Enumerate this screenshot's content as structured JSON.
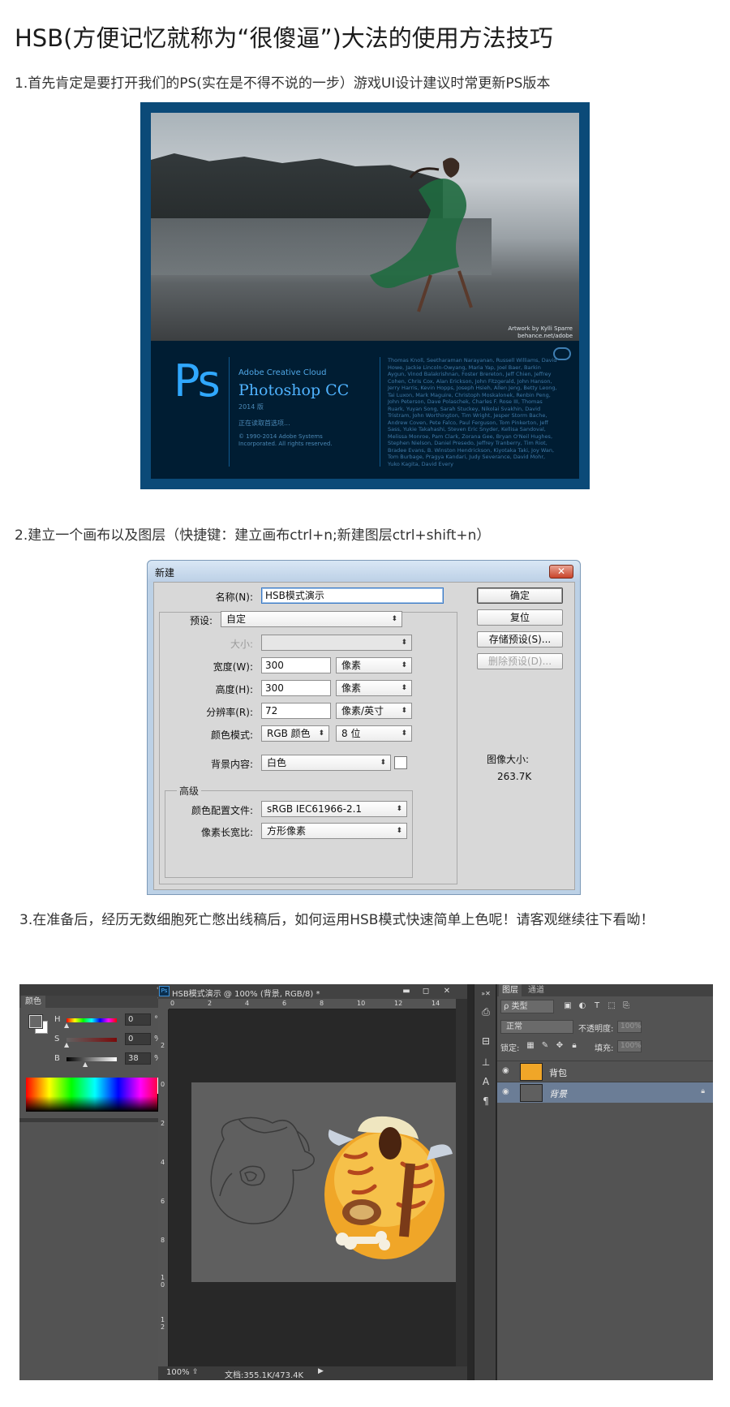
{
  "article": {
    "title": "HSB(方便记忆就称为“很傻逼”)大法的使用方法技巧",
    "step1": "1.首先肯定是要打开我们的PS(实在是不得不说的一步）游戏UI设计建议时常更新PS版本",
    "step2": "2.建立一个画布以及图层（快捷键：建立画布ctrl+n;新建图层ctrl+shift+n）",
    "step3": "3.在准备后，经历无数细胞死亡憋出线稿后，如何运用HSB模式快速简单上色呢！请客观继续往下看呦！"
  },
  "splash": {
    "artwork_credit": "Artwork by Kylli Sparre",
    "artwork_site": "behance.net/adobe",
    "logo": "Ps",
    "suite": "Adobe Creative Cloud",
    "product": "Photoshop CC",
    "year": "2014 版",
    "loading": "正在读取首选项...",
    "copyright": "© 1990-2014 Adobe Systems Incorporated. All rights reserved.",
    "credits": "Thomas Knoll, Seetharaman Narayanan, Russell Williams, David Howe, Jackie Lincoln-Owyang, Maria Yap, Joel Baer, Barkin Aygun, Vinod Balakrishnan, Foster Brereton, Jeff Chien, Jeffrey Cohen, Chris Cox, Alan Erickson, John Fitzgerald, John Hanson, Jerry Harris, Kevin Hopps, Joseph Hsieh, Allen Jeng, Betty Leong, Tai Luxon, Mark Maguire, Christoph Moskalonek, Renbin Peng, John Peterson, Dave Polaschek, Charles F. Rose III, Thomas Ruark, Yuyan Song, Sarah Stuckey, Nikolai Svakhin, David Tristram, John Worthington, Tim Wright, Jesper Storm Bache, Andrew Coven, Pete Falco, Paul Ferguson, Tom Pinkerton, Jeff Sass, Yukie Takahashi, Steven Eric Snyder, Kellisa Sandoval, Melissa Monroe, Pam Clark, Zorana Gee, Bryan O'Neil Hughes, Stephen Nielson, Daniel Presedo, Jeffrey Tranberry, Tim Riot, Bradee Evans, B. Winston Hendrickson, Kiyotaka Taki, Joy Wan, Tom Burbage, Pragya Kandari, Judy Severance, David Mohr, Yuko Kagita, David Every"
  },
  "dialog": {
    "title": "新建",
    "close": "✕",
    "name_label": "名称(N):",
    "name_value": "HSB模式演示",
    "preset_label": "预设:",
    "preset_value": "自定",
    "size_label": "大小:",
    "width_label": "宽度(W):",
    "width_value": "300",
    "width_unit": "像素",
    "height_label": "高度(H):",
    "height_value": "300",
    "height_unit": "像素",
    "resolution_label": "分辨率(R):",
    "resolution_value": "72",
    "resolution_unit": "像素/英寸",
    "mode_label": "颜色模式:",
    "mode_value": "RGB 颜色",
    "depth_value": "8 位",
    "bg_label": "背景内容:",
    "bg_value": "白色",
    "advanced_label": "高级",
    "profile_label": "颜色配置文件:",
    "profile_value": "sRGB IEC61966-2.1",
    "aspect_label": "像素长宽比:",
    "aspect_value": "方形像素",
    "btn_ok": "确定",
    "btn_reset": "复位",
    "btn_save": "存储预设(S)...",
    "btn_delete": "删除预设(D)...",
    "image_size_label": "图像大小:",
    "image_size_value": "263.7K"
  },
  "workspace": {
    "color_tab": "颜色",
    "h_label": "H",
    "h_value": "0",
    "h_unit": "°",
    "s_label": "S",
    "s_value": "0",
    "s_unit": "%",
    "b_label": "B",
    "b_value": "38",
    "b_unit": "%",
    "doc_title": "HSB模式演示 @ 100% (背景, RGB/8) *",
    "ruler_h": [
      "0",
      "2",
      "4",
      "6",
      "8",
      "10",
      "12",
      "14"
    ],
    "ruler_v": [
      "2",
      "0",
      "2",
      "4",
      "6",
      "8",
      "1 0",
      "1 2"
    ],
    "zoom": "100%",
    "doc_size": "文档:355.1K/473.4K",
    "layers_tab": "图层",
    "channels_tab": "通道",
    "filter_value": "ρ 类型",
    "blend_mode": "正常",
    "opacity_label": "不透明度:",
    "opacity_value": "100%",
    "lock_label": "锁定:",
    "fill_label": "填充:",
    "fill_value": "100%",
    "layer1_name": "背包",
    "layer2_name": "背景"
  },
  "colors": {
    "splash_border": "#0b4a78",
    "splash_panel": "#001d33",
    "ps_blue": "#30a8ff",
    "dialog_frame": "#bcd1e6",
    "layer_selected": "#6b7d96",
    "character_orange": "#f0a628"
  }
}
